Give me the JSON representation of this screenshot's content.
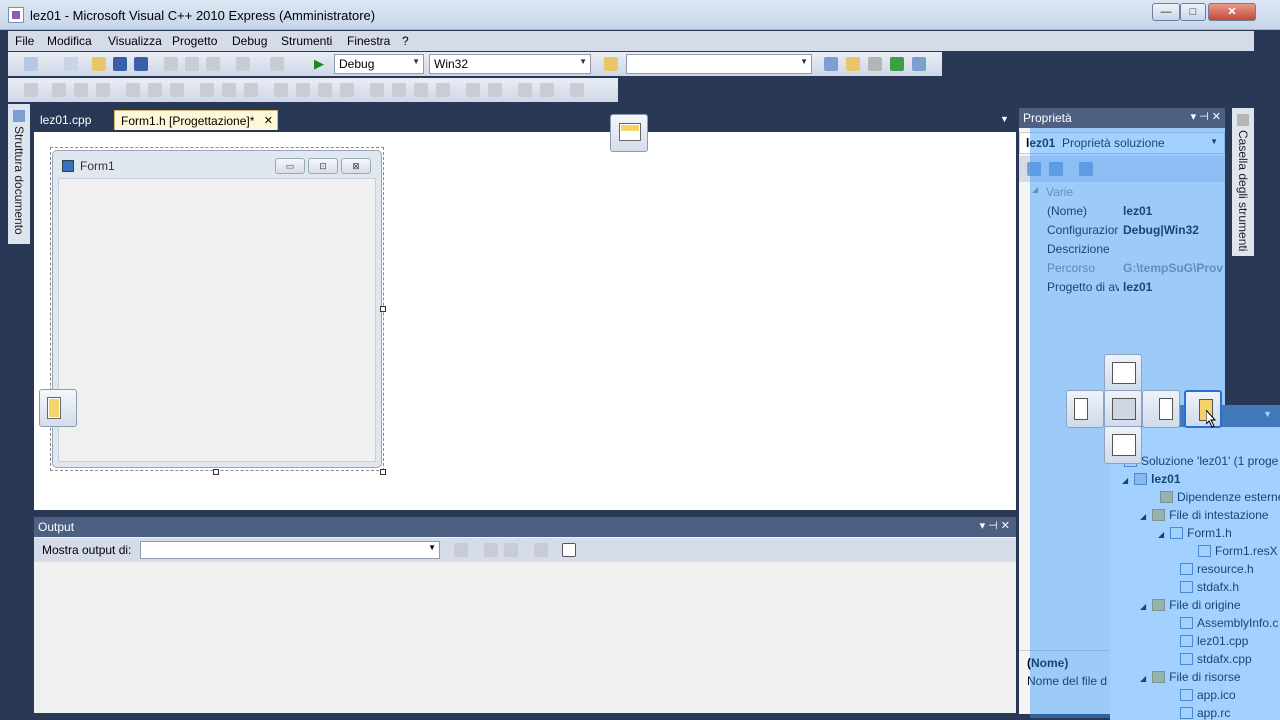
{
  "window": {
    "title": "lez01 - Microsoft Visual C++ 2010 Express (Amministratore)",
    "controls": {
      "minimize": "—",
      "maximize": "□",
      "close": "✕"
    }
  },
  "menu": [
    "File",
    "Modifica",
    "Visualizza",
    "Progetto",
    "Debug",
    "Strumenti",
    "Finestra",
    "?"
  ],
  "toolbar": {
    "config_value": "Debug",
    "platform_value": "Win32",
    "find_value": ""
  },
  "left_strip": {
    "label": "Struttura documento"
  },
  "tabs": [
    {
      "label": "lez01.cpp"
    },
    {
      "label": "Form1.h [Progettazione]*"
    }
  ],
  "tab_close": "✕",
  "tabs_dropdown": "▼",
  "form": {
    "title": "Form1",
    "buttons": {
      "minimize": "▭",
      "maximize": "⊡",
      "close": "⊠"
    }
  },
  "output": {
    "title": "Output",
    "label": "Mostra output di:",
    "select_value": "",
    "controls": "▾ ⊣ ✕"
  },
  "properties": {
    "title": "Proprietà",
    "controls": "▾ ⊣ ✕",
    "object_name": "lez01",
    "object_type": "Proprietà soluzione",
    "category": "Varie",
    "rows": [
      {
        "name": "(Nome)",
        "value": "lez01"
      },
      {
        "name": "Configurazior",
        "value": "Debug|Win32"
      },
      {
        "name": "Descrizione",
        "value": ""
      },
      {
        "name": "Percorso",
        "value": "G:\\tempSuG\\Prov"
      },
      {
        "name": "Progetto di av",
        "value": "lez01"
      }
    ],
    "desc_title": "(Nome)",
    "desc_text": "Nome del file d"
  },
  "right_strip": {
    "label": "Casella degli strumenti"
  },
  "solution": {
    "items": [
      {
        "label": "Soluzione 'lez01'  (1 proge",
        "level": 0,
        "icon": "solution-icon"
      },
      {
        "label": "lez01",
        "level": 1,
        "icon": "project-icon"
      },
      {
        "label": "Dipendenze esterne",
        "level": 2,
        "icon": "folder-icon"
      },
      {
        "label": "File di intestazione",
        "level": 2,
        "icon": "folder-icon"
      },
      {
        "label": "Form1.h",
        "level": 3,
        "icon": "header-file-icon"
      },
      {
        "label": "Form1.resX",
        "level": 4,
        "icon": "resx-file-icon"
      },
      {
        "label": "resource.h",
        "level": 3,
        "icon": "header-file-icon"
      },
      {
        "label": "stdafx.h",
        "level": 3,
        "icon": "header-file-icon"
      },
      {
        "label": "File di origine",
        "level": 2,
        "icon": "folder-icon"
      },
      {
        "label": "AssemblyInfo.c",
        "level": 3,
        "icon": "cpp-file-icon"
      },
      {
        "label": "lez01.cpp",
        "level": 3,
        "icon": "cpp-file-icon"
      },
      {
        "label": "stdafx.cpp",
        "level": 3,
        "icon": "cpp-file-icon"
      },
      {
        "label": "File di risorse",
        "level": 2,
        "icon": "folder-icon"
      },
      {
        "label": "app.ico",
        "level": 3,
        "icon": "ico-file-icon"
      },
      {
        "label": "app.rc",
        "level": 3,
        "icon": "rc-file-icon"
      }
    ]
  },
  "colors": {
    "chrome": "#293955",
    "panel_header": "#4d6082",
    "dock_highlight": "#3399ff",
    "active_tab": "#fff8d8"
  }
}
